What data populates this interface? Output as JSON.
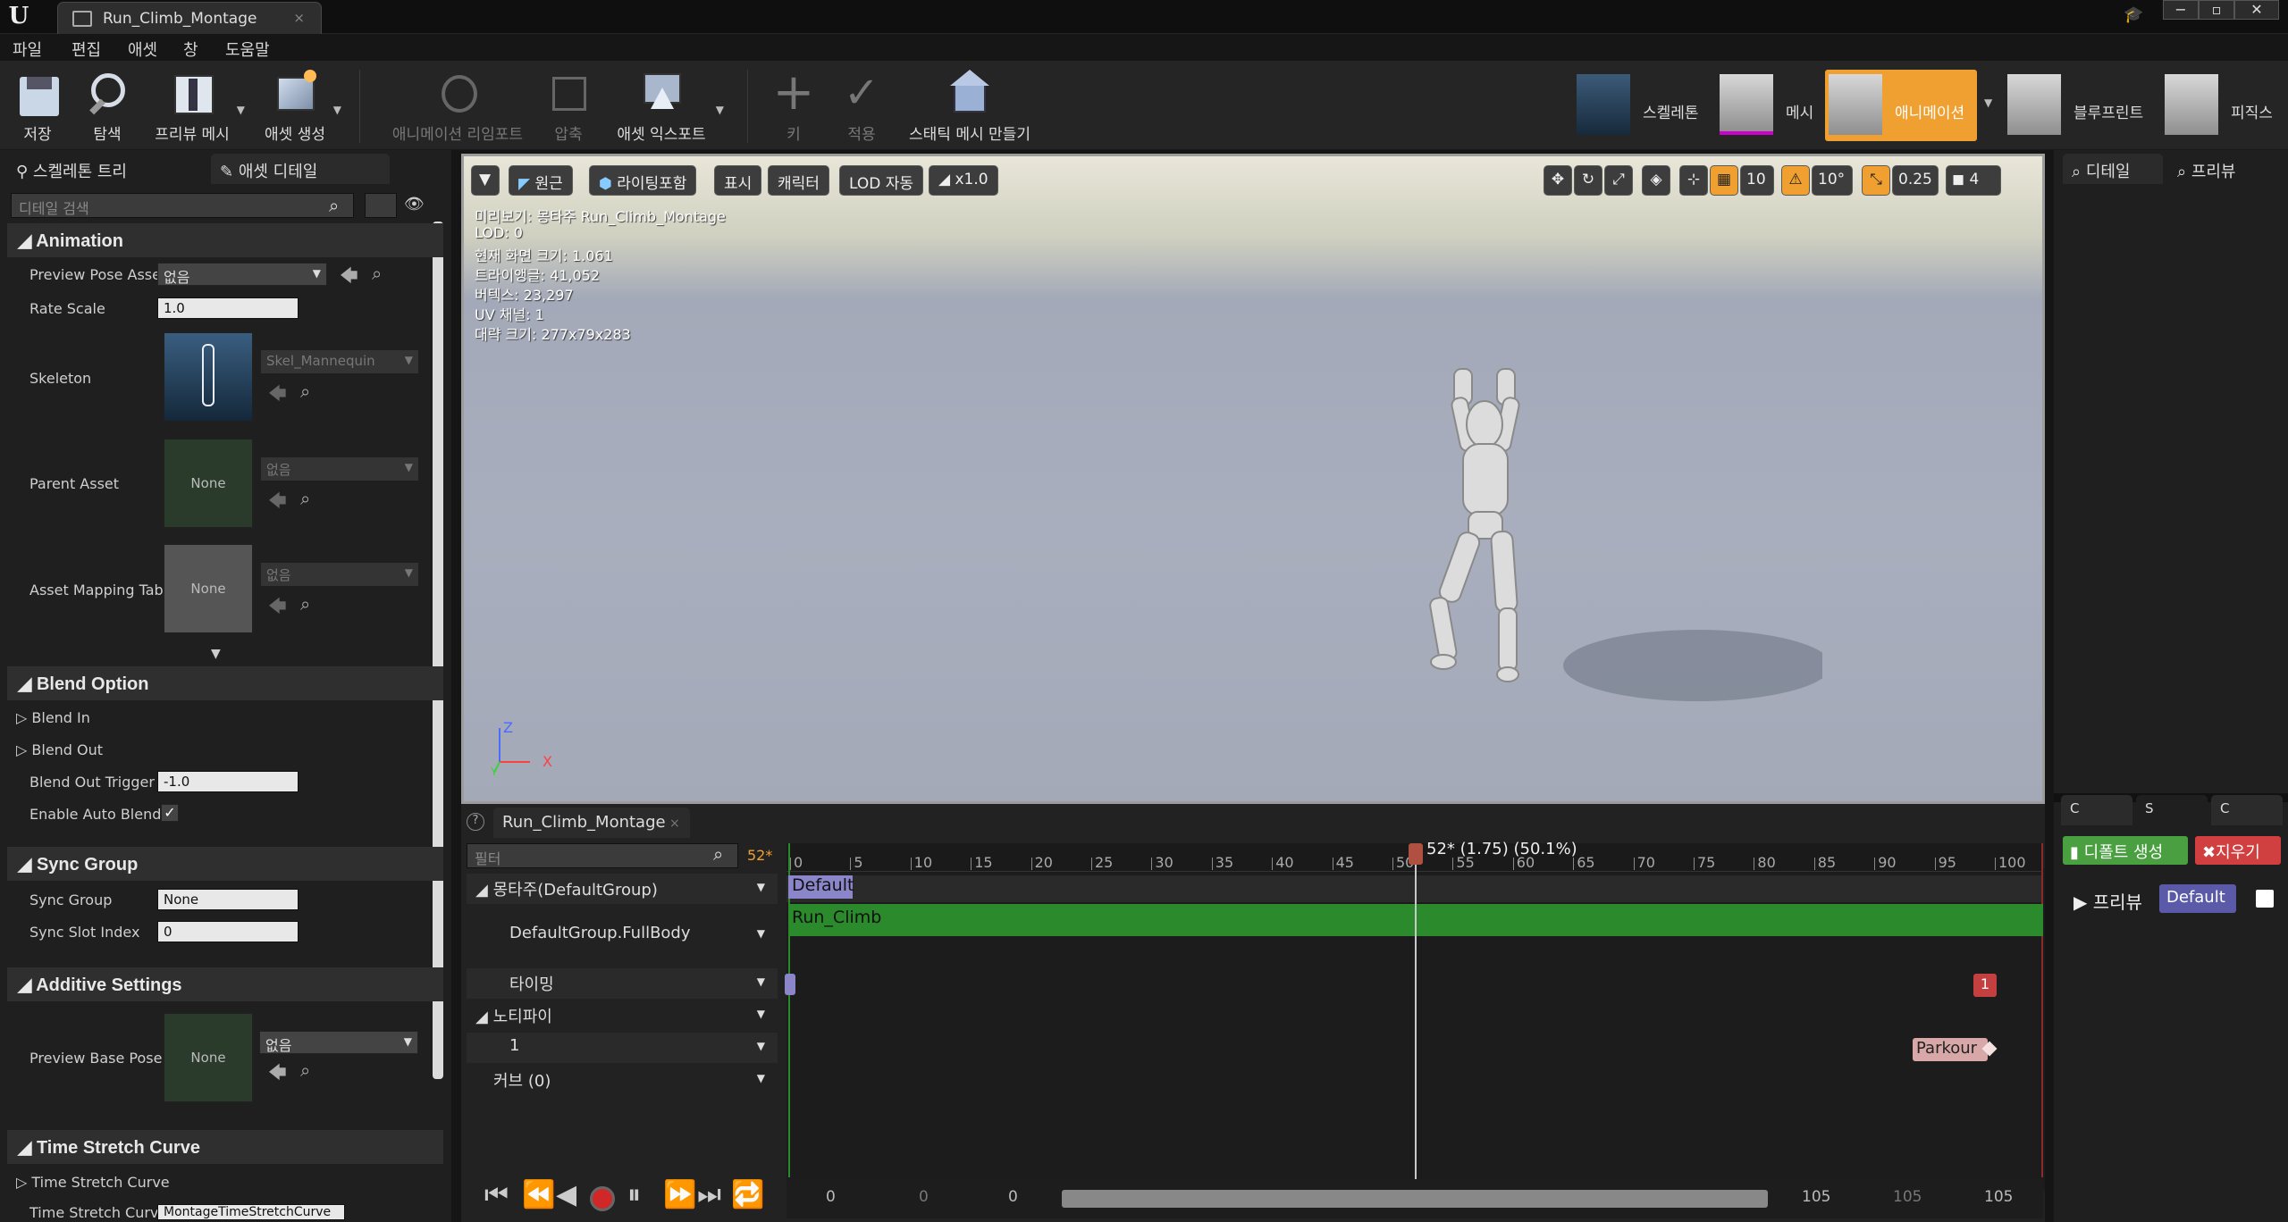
{
  "window": {
    "logo": "U",
    "tab_title": "Run_Climb_Montage",
    "tab_close": "×",
    "win_min": "−",
    "win_max": "▫",
    "win_close": "✕"
  },
  "menu": [
    "파일",
    "편집",
    "애셋",
    "창",
    "도움말"
  ],
  "toolbar": {
    "save": "저장",
    "browse": "탐색",
    "preview_mesh": "프리뷰 메시",
    "create_asset": "애셋 생성",
    "reimport": "애니메이션 리임포트",
    "compress": "압축",
    "export": "애셋 익스포트",
    "key": "키",
    "apply": "적용",
    "make_static": "스태틱 메시 만들기",
    "modes": {
      "skeleton": "스켈레톤",
      "mesh": "메시",
      "animation": "애니메이션",
      "blueprint": "블루프린트",
      "physics": "피직스"
    }
  },
  "left": {
    "tab_skeleton": "스켈레톤 트리",
    "tab_details": "애셋 디테일",
    "search_placeholder": "디테일 검색",
    "cat_animation": "Animation",
    "preview_pose_label": "Preview Pose Asset",
    "preview_pose_value": "없음",
    "rate_scale_label": "Rate Scale",
    "rate_scale_value": "1.0",
    "skeleton_label": "Skeleton",
    "skeleton_value": "Skel_Mannequin",
    "parent_label": "Parent Asset",
    "parent_value": "없음",
    "none": "None",
    "mapping_label": "Asset Mapping Tabl",
    "mapping_value": "없음",
    "cat_blend": "Blend Option",
    "blend_in": "Blend In",
    "blend_out": "Blend Out",
    "blend_out_trigger_label": "Blend Out Trigger T",
    "blend_out_trigger_value": "-1.0",
    "auto_blend_label": "Enable Auto Blend C",
    "cat_sync": "Sync Group",
    "sync_group_label": "Sync Group",
    "sync_group_value": "None",
    "sync_slot_label": "Sync Slot Index",
    "sync_slot_value": "0",
    "cat_additive": "Additive Settings",
    "preview_base_label": "Preview Base Pose",
    "preview_base_value": "없음",
    "cat_time": "Time Stretch Curve",
    "time_curve_label": "Time Stretch Curve",
    "time_curve2_label": "Time Stretch Curve",
    "time_curve2_value": "MontageTimeStretchCurve"
  },
  "viewport": {
    "perspective": "원근",
    "lighting": "라이팅포함",
    "show": "표시",
    "character": "캐릭터",
    "lod": "LOD 자동",
    "speed": "x1.0",
    "grid_snap": "10",
    "rot_snap": "10°",
    "scale_snap": "0.25",
    "cam_speed": "4",
    "info": [
      "미리보기: 몽타주 Run_Climb_Montage",
      "LOD: 0",
      "현재 화면 크기: 1.061",
      "트라이앵글: 41,052",
      "버텍스: 23,297",
      "UV 채널: 1",
      "대략 크기: 277x79x283"
    ],
    "axis_z": "Z",
    "axis_x": "X",
    "axis_y": "Y"
  },
  "right": {
    "tab_details": "디테일",
    "tab_preview": "프리뷰",
    "sub_tabs": [
      "C",
      "S",
      "C"
    ],
    "default_btn": "디폴트 생성",
    "clear_btn": "지우기",
    "preview_label": "프리뷰",
    "default_tag": "Default"
  },
  "timeline": {
    "tab": "Run_Climb_Montage",
    "filter_placeholder": "필터",
    "frame_indicator": "52*",
    "playhead_label": "52* (1.75) (50.1%)",
    "ruler": [
      "0",
      "5",
      "10",
      "15",
      "20",
      "25",
      "30",
      "35",
      "40",
      "45",
      "50",
      "55",
      "60",
      "65",
      "70",
      "75",
      "80",
      "85",
      "90",
      "95",
      "100"
    ],
    "rows": {
      "montage": "몽타주(DefaultGroup)",
      "slot": "DefaultGroup.FullBody",
      "timing": "타이밍",
      "notifies": "노티파이",
      "notify_track": "1",
      "curves": "커브 (0)"
    },
    "section": "Default",
    "segment": "Run_Climb",
    "timing_marker": "1",
    "notify_name": "Parkour",
    "footer": {
      "a": "0",
      "b": "0",
      "c": "0",
      "d": "105",
      "e": "105",
      "f": "105"
    }
  },
  "colors": {
    "accent": "#f0a030",
    "segment": "#2b8a2b",
    "section": "#8a86c9",
    "timing": "#c44040"
  }
}
